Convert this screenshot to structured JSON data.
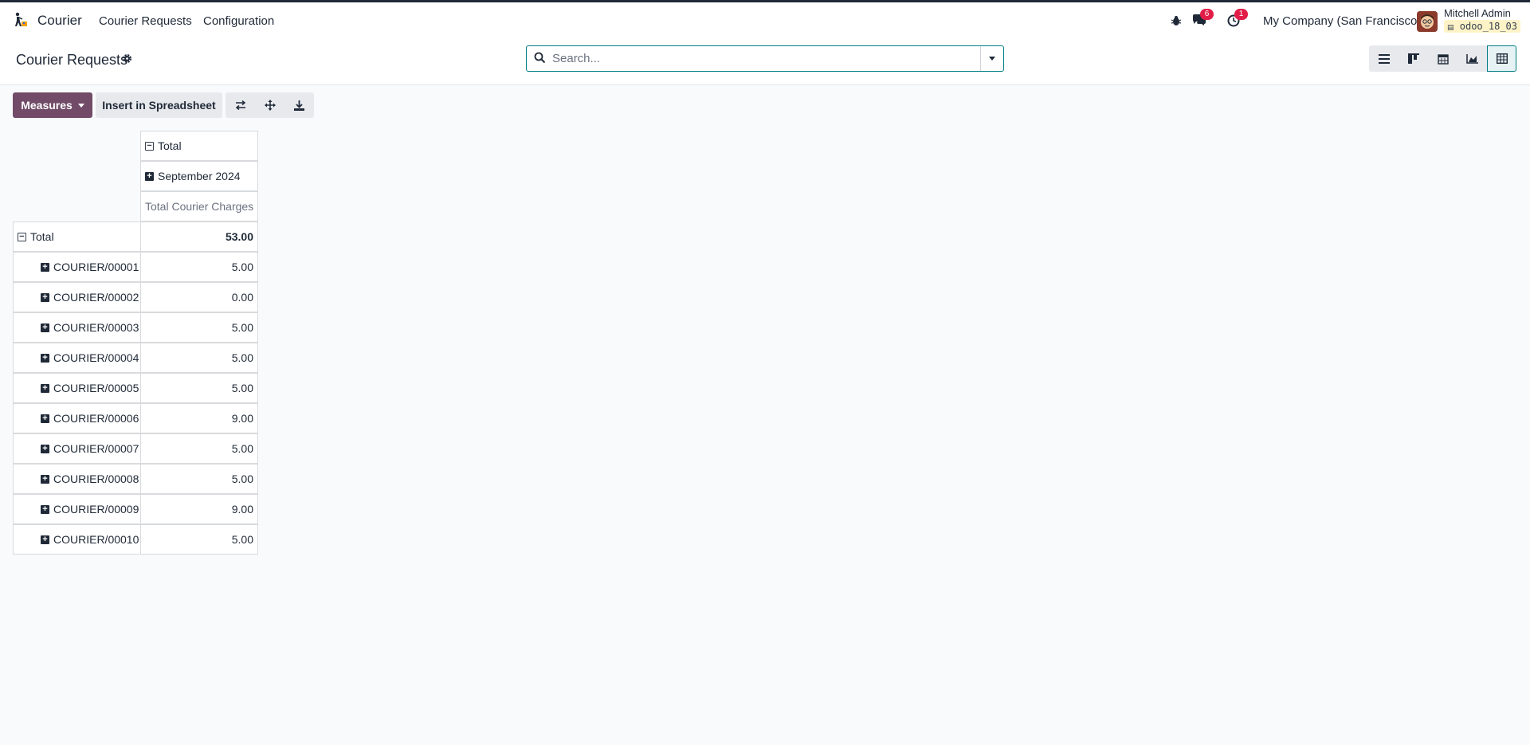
{
  "navbar": {
    "app_name": "Courier",
    "menu": [
      "Courier Requests",
      "Configuration"
    ],
    "messages_badge": "6",
    "activities_badge": "1",
    "company": "My Company (San Francisco)",
    "user_name": "Mitchell Admin",
    "database": "odoo_18_03"
  },
  "control": {
    "breadcrumb": "Courier Requests",
    "search_placeholder": "Search...",
    "views": [
      "list-view",
      "kanban-view",
      "calendar-view",
      "graph-view",
      "pivot-view"
    ],
    "active_view": "pivot-view"
  },
  "toolbar": {
    "measures_label": "Measures",
    "insert_label": "Insert in Spreadsheet",
    "icons": [
      "flip-axis-icon",
      "expand-all-icon",
      "download-icon"
    ]
  },
  "pivot": {
    "col_header_total": "Total",
    "col_header_period": "September 2024",
    "measure": "Total Courier Charges",
    "row_total_label": "Total",
    "row_total_value": "53.00",
    "rows": [
      {
        "label": "COURIER/00001",
        "value": "5.00"
      },
      {
        "label": "COURIER/00002",
        "value": "0.00"
      },
      {
        "label": "COURIER/00003",
        "value": "5.00"
      },
      {
        "label": "COURIER/00004",
        "value": "5.00"
      },
      {
        "label": "COURIER/00005",
        "value": "5.00"
      },
      {
        "label": "COURIER/00006",
        "value": "9.00"
      },
      {
        "label": "COURIER/00007",
        "value": "5.00"
      },
      {
        "label": "COURIER/00008",
        "value": "5.00"
      },
      {
        "label": "COURIER/00009",
        "value": "9.00"
      },
      {
        "label": "COURIER/00010",
        "value": "5.00"
      }
    ]
  }
}
